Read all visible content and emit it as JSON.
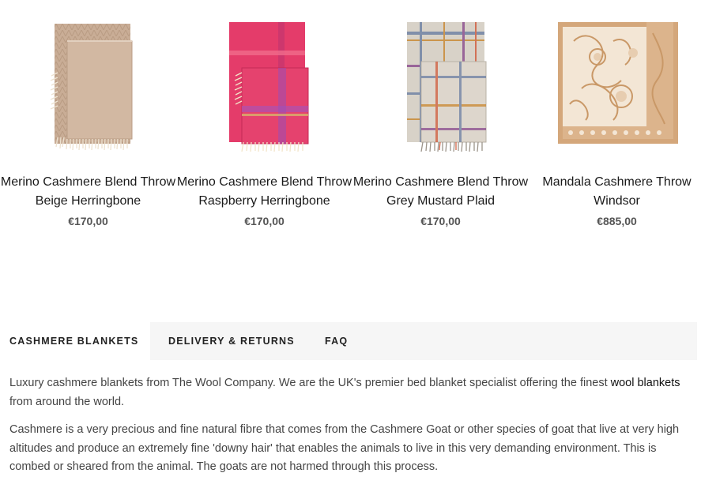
{
  "products": [
    {
      "name": "Merino Cashmere Blend Throw Beige Herringbone",
      "price": "€170,00",
      "image_icon": "beige-herringbone-throw-image",
      "colors": {
        "main": "#c9ad96",
        "fringe": "#ede2d0"
      }
    },
    {
      "name": "Merino Cashmere Blend Throw Raspberry Herringbone",
      "price": "€170,00",
      "image_icon": "raspberry-herringbone-throw-image",
      "colors": {
        "main": "#e43c6a",
        "fringe": "#f2e4c8"
      }
    },
    {
      "name": "Merino Cashmere Blend Throw Grey Mustard Plaid",
      "price": "€170,00",
      "image_icon": "grey-mustard-plaid-throw-image",
      "colors": {
        "main": "#d8d2c8",
        "fringe": "#b8b0a6"
      }
    },
    {
      "name": "Mandala Cashmere Throw Windsor",
      "price": "€885,00",
      "image_icon": "mandala-windsor-throw-image",
      "colors": {
        "main": "#f3e6d5",
        "pattern": "#d4a77b"
      }
    }
  ],
  "tabs": [
    {
      "label": "Cashmere Blankets",
      "active": true
    },
    {
      "label": "Delivery & Returns",
      "active": false
    },
    {
      "label": "FAQ",
      "active": false
    }
  ],
  "content": {
    "p1_before": "Luxury cashmere blankets from The Wool Company. We are the UK's premier bed blanket specialist offering the finest ",
    "p1_link": "wool blankets",
    "p1_after": " from around the world.",
    "p2": "Cashmere is a very precious and fine natural fibre that comes from the Cashmere Goat or other species of goat that live at very high altitudes and produce an extremely fine 'downy hair' that enables the animals to live in this very demanding environment. This is combed or sheared from the animal. The goats are not harmed through this process."
  }
}
